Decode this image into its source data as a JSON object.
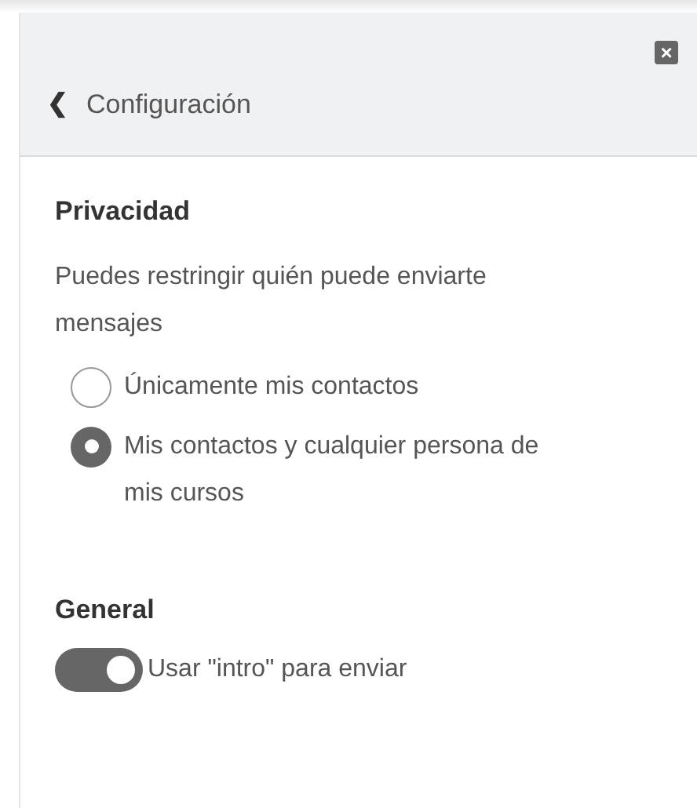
{
  "header": {
    "close_icon": "×",
    "back_icon": "❮",
    "title": "Configuración"
  },
  "privacy": {
    "heading": "Privacidad",
    "description": "Puedes restringir quién puede enviarte mensajes",
    "options": [
      {
        "label": "Únicamente mis contactos",
        "selected": false
      },
      {
        "label": "Mis contactos y cualquier persona de mis cursos",
        "selected": true
      }
    ]
  },
  "general": {
    "heading": "General",
    "toggle": {
      "label": "Usar \"intro\" para enviar",
      "on": true
    }
  }
}
